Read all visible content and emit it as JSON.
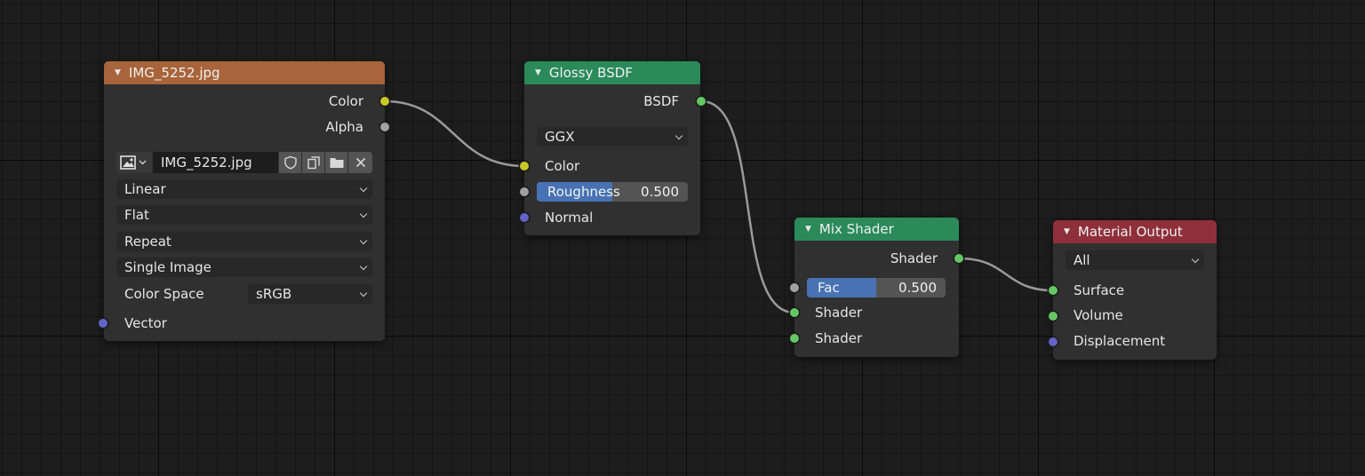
{
  "nodes": {
    "image_texture": {
      "title": "IMG_5252.jpg",
      "header_color": "#a8643a",
      "outputs": [
        "Color",
        "Alpha"
      ],
      "image_name": "IMG_5252.jpg",
      "interpolation": "Linear",
      "projection": "Flat",
      "extension": "Repeat",
      "source": "Single Image",
      "color_space_label": "Color Space",
      "color_space": "sRGB",
      "inputs": [
        "Vector"
      ]
    },
    "glossy_bsdf": {
      "title": "Glossy BSDF",
      "header_color": "#2a8a5a",
      "output": "BSDF",
      "distribution": "GGX",
      "color_label": "Color",
      "roughness_label": "Roughness",
      "roughness_value": "0.500",
      "roughness_fraction": 0.5,
      "normal_label": "Normal"
    },
    "mix_shader": {
      "title": "Mix Shader",
      "header_color": "#2a8a5a",
      "output": "Shader",
      "fac_label": "Fac",
      "fac_value": "0.500",
      "fac_fraction": 0.5,
      "inputs": [
        "Shader",
        "Shader"
      ]
    },
    "material_output": {
      "title": "Material Output",
      "header_color": "#8e2f3a",
      "target": "All",
      "inputs": [
        "Surface",
        "Volume",
        "Displacement"
      ]
    }
  },
  "colors": {
    "socket_color": "#c7c729",
    "socket_float": "#a1a1a1",
    "socket_vector": "#6363c7",
    "socket_shader": "#63c763",
    "slider_fill": "#4772b3",
    "link": "#9a9a9a"
  }
}
